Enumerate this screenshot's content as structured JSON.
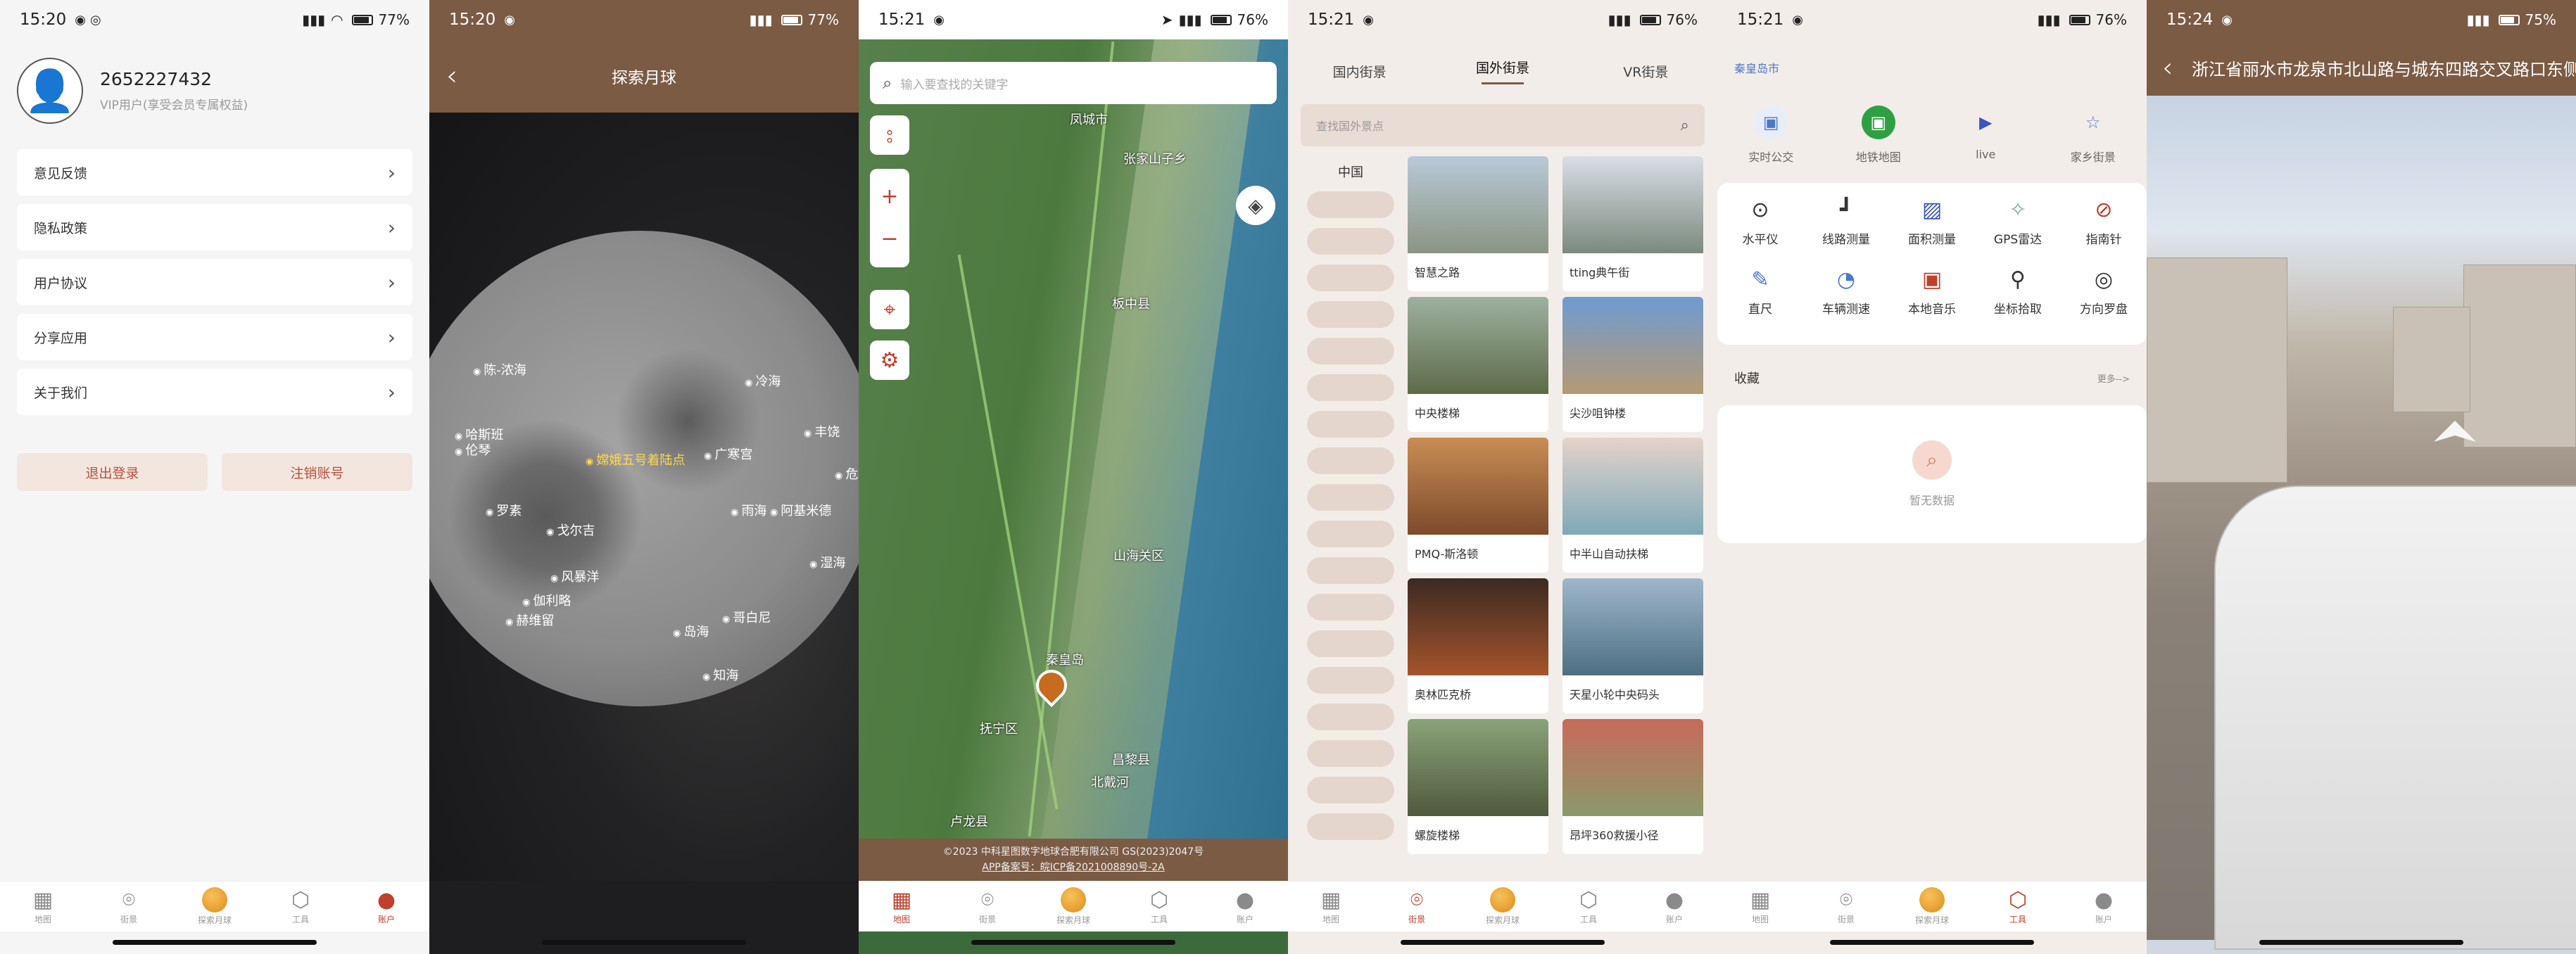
{
  "status": {
    "s1": {
      "time": "15:20",
      "right": "77%"
    },
    "s2": {
      "time": "15:20",
      "right": "77%"
    },
    "s3": {
      "time": "15:21",
      "right": "76%"
    },
    "s4": {
      "time": "15:21",
      "right": "76%"
    },
    "s5": {
      "time": "15:21",
      "right": "76%"
    },
    "s6": {
      "time": "15:24",
      "right": "75%"
    }
  },
  "nav": [
    {
      "label": "地图",
      "icon": "map-icon"
    },
    {
      "label": "街景",
      "icon": "street-view-icon"
    },
    {
      "label": "探索月球",
      "icon": "moon-icon"
    },
    {
      "label": "工具",
      "icon": "cube-icon"
    },
    {
      "label": "账户",
      "icon": "user-icon"
    }
  ],
  "account": {
    "user_id": "2652227432",
    "vip": "VIP用户(享受会员专属权益)",
    "menu": [
      "意见反馈",
      "隐私政策",
      "用户协议",
      "分享应用",
      "关于我们"
    ],
    "logout": "退出登录",
    "delete": "注销账号"
  },
  "moon": {
    "title": "探索月球",
    "labels": [
      {
        "text": "嫦娥五号着陆点",
        "highlight": true
      },
      {
        "text": "陈-浓海"
      },
      {
        "text": "冷海"
      },
      {
        "text": "哈斯班"
      },
      {
        "text": "伦琴"
      },
      {
        "text": "广寒宫"
      },
      {
        "text": "丰饶"
      },
      {
        "text": "危"
      },
      {
        "text": "罗素"
      },
      {
        "text": "戈尔吉"
      },
      {
        "text": "雨海"
      },
      {
        "text": "阿基米德"
      },
      {
        "text": "风暴洋"
      },
      {
        "text": "伽利略"
      },
      {
        "text": "赫维留"
      },
      {
        "text": "哥白尼"
      },
      {
        "text": "岛海"
      },
      {
        "text": "知海"
      },
      {
        "text": "湿海"
      }
    ]
  },
  "map": {
    "search_placeholder": "输入要查找的关键字",
    "places": [
      "凤城市",
      "张家山子乡",
      "板中县",
      "山海关区",
      "秦皇岛",
      "抚宁区",
      "北戴河",
      "昌黎县",
      "卢龙县"
    ],
    "copyright1": "©2023 中科星图数字地球合肥有限公司 GS(2023)2047号",
    "copyright2": "APP备案号：皖ICP备2021008890号-2A"
  },
  "street": {
    "tabs": [
      "国内街景",
      "国外街景",
      "VR街景"
    ],
    "active_tab": "国外街景",
    "search_placeholder": "查找国外景点",
    "country": "中国",
    "cards": [
      "智慧之路",
      "tting典午街",
      "中央楼梯",
      "尖沙咀钟楼",
      "PMQ-斯洛顿",
      "中半山自动扶梯",
      "奥林匹克桥",
      "天星小轮中央码头",
      "螺旋楼梯",
      "昂坪360救援小径"
    ]
  },
  "tools": {
    "city": "秦皇岛市",
    "top": [
      {
        "label": "实时公交",
        "icon": "bus-icon",
        "color": "#4b78c8"
      },
      {
        "label": "地铁地图",
        "icon": "subway-icon",
        "color": "#2ea043"
      },
      {
        "label": "live",
        "icon": "live-camera-icon",
        "color": "#3a56c5"
      },
      {
        "label": "家乡街景",
        "icon": "star-icon",
        "color": "#4b78c8"
      }
    ],
    "grid": [
      {
        "label": "水平仪",
        "icon": "level-icon",
        "glyph": "⊙"
      },
      {
        "label": "线路测量",
        "icon": "route-measure-icon",
        "glyph": "┛"
      },
      {
        "label": "面积测量",
        "icon": "area-measure-icon",
        "glyph": "▨"
      },
      {
        "label": "GPS雷达",
        "icon": "gps-radar-icon",
        "glyph": "✧"
      },
      {
        "label": "指南针",
        "icon": "compass-icon",
        "glyph": "⊘"
      },
      {
        "label": "直尺",
        "icon": "ruler-icon",
        "glyph": "✎"
      },
      {
        "label": "车辆测速",
        "icon": "speedometer-icon",
        "glyph": "◔"
      },
      {
        "label": "本地音乐",
        "icon": "music-icon",
        "glyph": "▣"
      },
      {
        "label": "坐标拾取",
        "icon": "coordinate-pick-icon",
        "glyph": "⚲"
      },
      {
        "label": "方向罗盘",
        "icon": "direction-compass-icon",
        "glyph": "◎"
      }
    ],
    "favorites": "收藏",
    "more": "更多-->",
    "empty": "暂无数据"
  },
  "pano": {
    "title": "浙江省丽水市龙泉市北山路与城东四路交叉路口东侧"
  }
}
